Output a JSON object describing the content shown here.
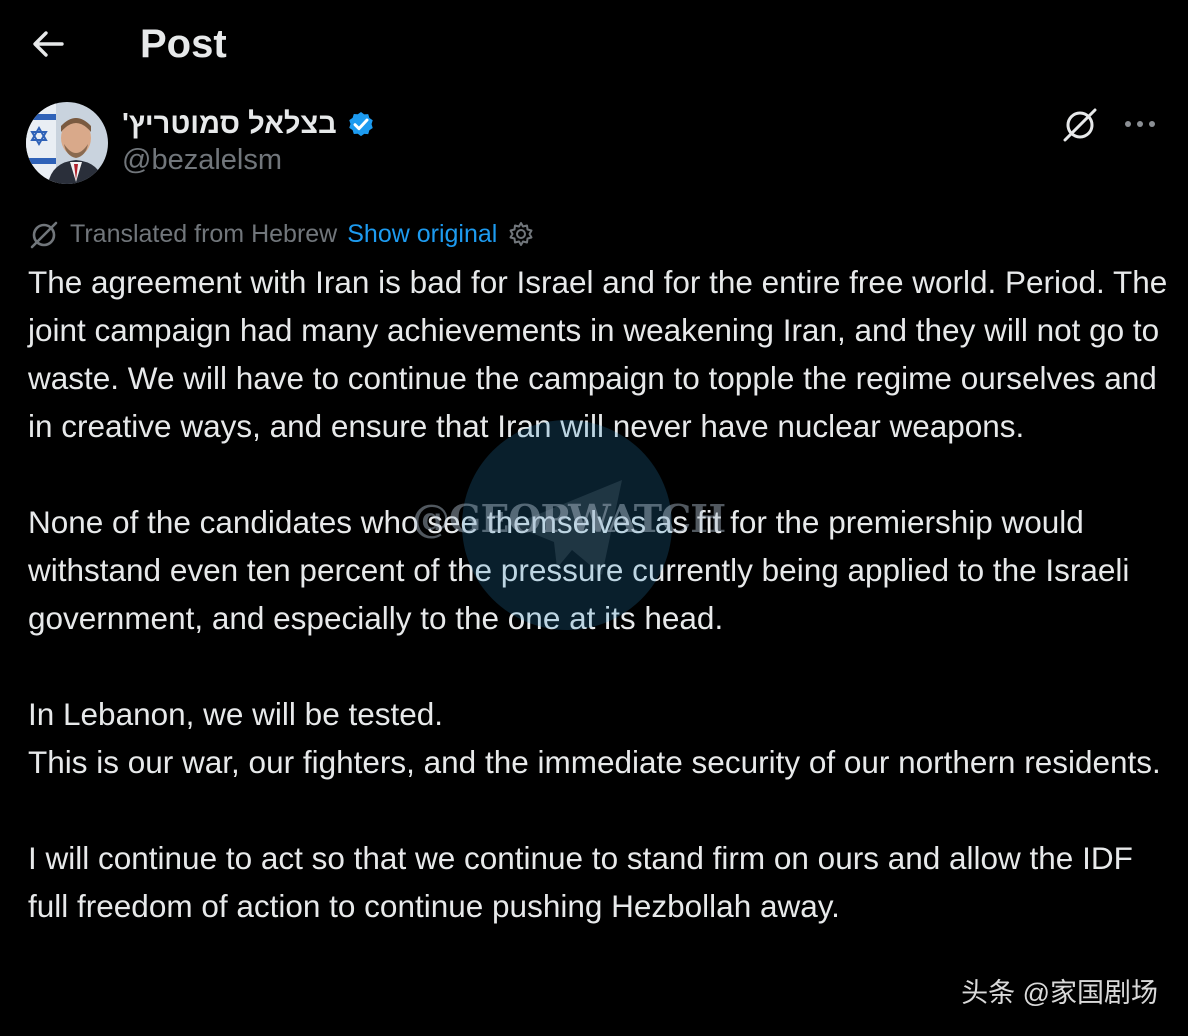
{
  "header": {
    "title": "Post",
    "back_icon": "arrow-left-icon"
  },
  "author": {
    "display_name": "בצלאל סמוטריץ'",
    "handle": "@bezalelsm",
    "verified": true,
    "verified_color": "#1d9bf0"
  },
  "actions": {
    "grok_icon": "grok-icon",
    "more_icon": "more-icon"
  },
  "translation": {
    "label": "Translated from Hebrew",
    "show_original": "Show original",
    "settings_icon": "gear-icon"
  },
  "post": {
    "paragraphs": [
      "The agreement with Iran is bad for Israel and for the entire free world. Period. The joint campaign had many achievements in weakening Iran, and they will not go to waste. We will have to continue the campaign to topple the regime ourselves and in creative ways, and ensure that Iran will never have nuclear weapons.",
      "None of the candidates who see themselves as fit for the premiership would withstand even ten percent of the pressure currently being applied to the Israeli government, and especially to the one at its head.",
      "In Lebanon, we will be tested.",
      "This is our war, our fighters, and the immediate security of our northern residents.",
      "I will continue to act so that we continue to stand firm on ours and allow the IDF full freedom of action to continue pushing Hezbollah away."
    ]
  },
  "overlays": {
    "watermark": "@GEOPWATCH",
    "source_mark": "头条 @家国剧场"
  },
  "colors": {
    "background": "#000000",
    "text": "#e7e9ea",
    "secondary": "#71767b",
    "link": "#1d9bf0"
  }
}
